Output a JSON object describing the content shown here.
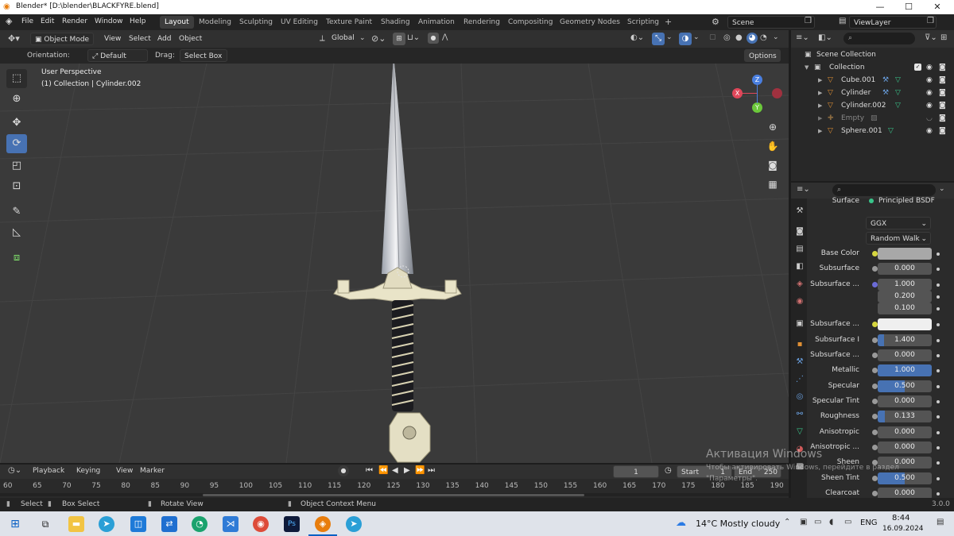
{
  "window": {
    "title": "Blender* [D:\\blender\\BLACKFYRE.blend]",
    "min": "—",
    "max": "☐",
    "close": "✕"
  },
  "menu": [
    "File",
    "Edit",
    "Render",
    "Window",
    "Help"
  ],
  "workspaces": [
    "Layout",
    "Modeling",
    "Sculpting",
    "UV Editing",
    "Texture Paint",
    "Shading",
    "Animation",
    "Rendering",
    "Compositing",
    "Geometry Nodes",
    "Scripting",
    "+"
  ],
  "scene": {
    "label": "Scene",
    "view_layer": "ViewLayer"
  },
  "viewport_header": {
    "mode": "Object Mode",
    "menus": [
      "View",
      "Select",
      "Add",
      "Object"
    ],
    "transform": "Global",
    "options": "Options"
  },
  "tool_settings": {
    "orientation_label": "Orientation:",
    "orientation_value": "Default",
    "drag_label": "Drag:",
    "drag_value": "Select Box"
  },
  "viewport": {
    "perspective": "User Perspective",
    "collection": "(1) Collection | Cylinder.002",
    "gizmo": {
      "z": "Z",
      "x": "X",
      "y": "Y"
    }
  },
  "outliner": {
    "root": "Scene Collection",
    "collection": "Collection",
    "items": [
      "Cube.001",
      "Cylinder",
      "Cylinder.002",
      "Empty",
      "Sphere.001"
    ]
  },
  "properties": {
    "surface_label": "Surface",
    "surface_value": "Principled BSDF",
    "distribution": "GGX",
    "subsurface_method": "Random Walk",
    "rows": [
      {
        "label": "Base Color",
        "type": "color",
        "color": "#a8a8a8",
        "dot": "#d6d640"
      },
      {
        "label": "Subsurface",
        "value": "0.000",
        "fill": 0,
        "dot": "#9a9a9a"
      },
      {
        "label": "Subsurface ...",
        "value": "1.000",
        "fill": 0,
        "dot": "#6b6bd6"
      },
      {
        "label": "",
        "value": "0.200",
        "fill": 0
      },
      {
        "label": "",
        "value": "0.100",
        "fill": 0
      },
      {
        "label": "Subsurface ...",
        "type": "color",
        "color": "#efefef",
        "dot": "#d6d640"
      },
      {
        "label": "Subsurface I",
        "value": "1.400",
        "fill": 0.12,
        "dot": "#9a9a9a"
      },
      {
        "label": "Subsurface ...",
        "value": "0.000",
        "fill": 0,
        "dot": "#9a9a9a"
      },
      {
        "label": "Metallic",
        "value": "1.000",
        "fill": 1.0,
        "dot": "#9a9a9a"
      },
      {
        "label": "Specular",
        "value": "0.500",
        "fill": 0.5,
        "dot": "#9a9a9a"
      },
      {
        "label": "Specular Tint",
        "value": "0.000",
        "fill": 0,
        "dot": "#9a9a9a"
      },
      {
        "label": "Roughness",
        "value": "0.133",
        "fill": 0.133,
        "dot": "#9a9a9a"
      },
      {
        "label": "Anisotropic",
        "value": "0.000",
        "fill": 0,
        "dot": "#9a9a9a"
      },
      {
        "label": "Anisotropic ...",
        "value": "0.000",
        "fill": 0,
        "dot": "#9a9a9a"
      },
      {
        "label": "Sheen",
        "value": "0.000",
        "fill": 0,
        "dot": "#9a9a9a"
      },
      {
        "label": "Sheen Tint",
        "value": "0.500",
        "fill": 0.5,
        "dot": "#9a9a9a"
      },
      {
        "label": "Clearcoat",
        "value": "0.000",
        "fill": 0,
        "dot": "#9a9a9a"
      }
    ]
  },
  "timeline": {
    "menus": [
      "Playback",
      "Keying",
      "View",
      "Marker"
    ],
    "current_frame": "1",
    "start_label": "Start",
    "start": "1",
    "end_label": "End",
    "end": "250",
    "ticks": [
      "60",
      "65",
      "70",
      "75",
      "80",
      "85",
      "90",
      "95",
      "100",
      "105",
      "110",
      "115",
      "120",
      "125",
      "130",
      "135",
      "140",
      "145",
      "150",
      "155",
      "160",
      "165",
      "170",
      "175",
      "180",
      "185",
      "190"
    ]
  },
  "status": {
    "select": "Select",
    "box_select": "Box Select",
    "rotate": "Rotate View",
    "context": "Object Context Menu",
    "version": "3.0.0"
  },
  "activation": {
    "title": "Активация Windows",
    "line1": "Чтобы активировать Windows, перейдите в раздел",
    "line2": "\"Параметры\"."
  },
  "taskbar": {
    "weather": "14°C  Mostly cloudy",
    "lang": "ENG",
    "time": "8:44",
    "date": "16.09.2024"
  },
  "colors": {
    "accent": "#4772b3",
    "orange": "#e09034",
    "green": "#39c58a"
  }
}
